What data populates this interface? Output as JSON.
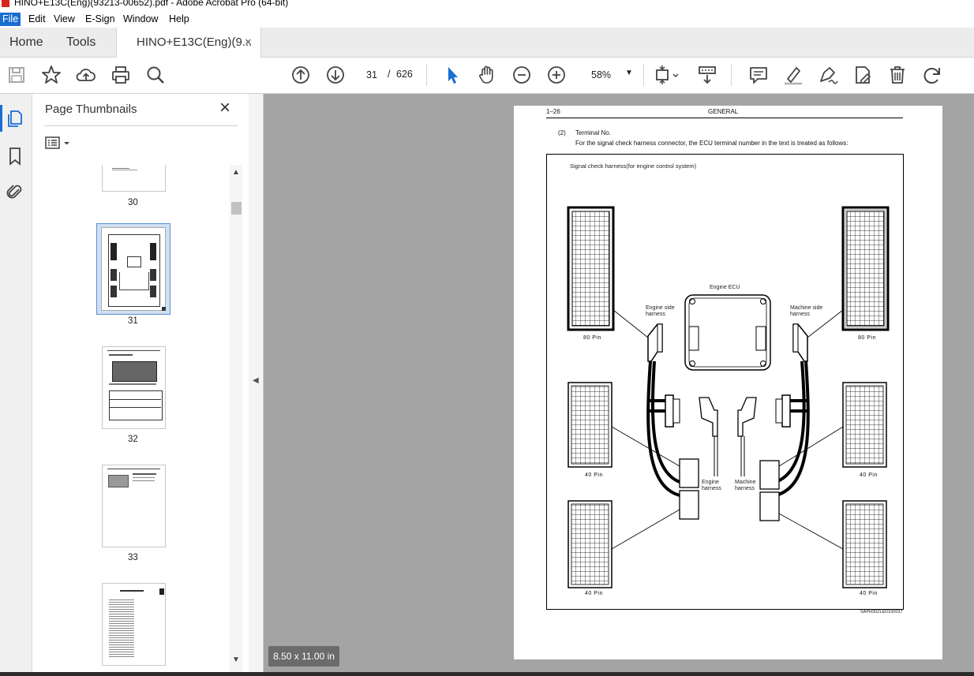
{
  "window": {
    "title": "HINO+E13C(Eng)(93213-00652).pdf - Adobe Acrobat Pro (64-bit)"
  },
  "menu": [
    "File",
    "Edit",
    "View",
    "E-Sign",
    "Window",
    "Help"
  ],
  "tabs": {
    "home": "Home",
    "tools": "Tools",
    "document": "HINO+E13C(Eng)(9...",
    "close": "×"
  },
  "toolbar": {
    "current_page": "31",
    "page_separator": "/",
    "total_pages": "626",
    "zoom": "58%"
  },
  "icons": {
    "left_toolbar": [
      "save-icon",
      "star-icon",
      "cloud-upload-icon",
      "print-icon",
      "search-icon"
    ],
    "nav": [
      "page-up-icon",
      "page-down-icon"
    ],
    "tools": [
      "select-arrow-icon",
      "hand-icon",
      "zoom-out-icon",
      "zoom-in-icon"
    ],
    "right_toolbar": [
      "page-fit-icon",
      "scroll-mode-icon",
      "comment-icon",
      "highlight-icon",
      "sign-icon",
      "edit-pdf-icon",
      "delete-icon",
      "rotate-icon"
    ],
    "rail": [
      "pages-icon",
      "bookmark-icon",
      "attachment-icon"
    ]
  },
  "panel": {
    "title": "Page Thumbnails",
    "close": "×",
    "thumbnails": [
      {
        "label": "30"
      },
      {
        "label": "31",
        "selected": true
      },
      {
        "label": "32"
      },
      {
        "label": "33"
      },
      {
        "label": ""
      }
    ]
  },
  "page_size": "8.50 x 11.00 in",
  "document": {
    "header_left": "1–26",
    "header_center": "GENERAL",
    "item_number": "(2)",
    "item_title": "Terminal No.",
    "item_text": "For the signal check harness connector, the ECU terminal number in the text is treated as follows:",
    "figure_caption": "Signal check harness(for engine control system)",
    "labels": {
      "engine_ecu": "Engine ECU",
      "engine_side_harness": "Engine side harness",
      "machine_side_harness": "Machine side harness",
      "engine_harness": "Engine harness",
      "machine_harness": "Machine harness",
      "pin80_left": "80 Pin",
      "pin80_right": "80 Pin",
      "pin40_ml": "40 Pin",
      "pin40_mr": "40 Pin",
      "pin40_bl": "40 Pin",
      "pin40_br": "40 Pin"
    },
    "figure_code": "SAPH30ZLED100037"
  },
  "colors": {
    "accent": "#1a6dd3",
    "viewer_bg": "#a4a4a4",
    "title_icon": "#d9251c"
  }
}
